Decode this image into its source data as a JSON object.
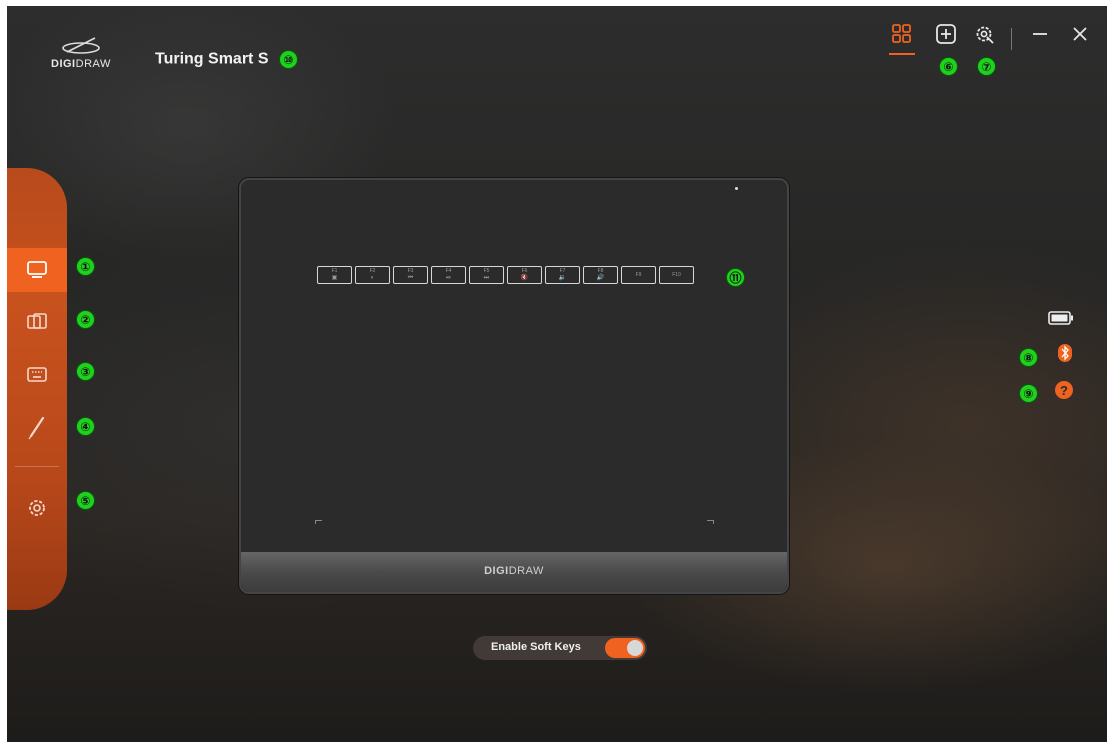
{
  "app": {
    "brand": "DIGIDRAW",
    "brand_bold": "DIGI",
    "brand_light": "DRAW",
    "device_name": "Turing Smart S",
    "accent": "#f0621f"
  },
  "topbar": {
    "buttons": [
      {
        "name": "device-overview",
        "icon": "grid-icon",
        "active": true
      },
      {
        "name": "add-device",
        "icon": "plus-square-icon"
      },
      {
        "name": "app-settings",
        "icon": "gear-badge-icon"
      },
      {
        "name": "minimize",
        "icon": "minimize-icon"
      },
      {
        "name": "close",
        "icon": "close-icon"
      }
    ]
  },
  "sidebar": {
    "items": [
      {
        "name": "display",
        "icon": "monitor-icon",
        "active": true
      },
      {
        "name": "multi-display",
        "icon": "screens-icon"
      },
      {
        "name": "keyboard",
        "icon": "keyboard-icon"
      },
      {
        "name": "pen",
        "icon": "pen-icon"
      },
      {
        "name": "settings",
        "icon": "gear-icon"
      }
    ]
  },
  "tablet": {
    "brand_bold": "DIGI",
    "brand_light": "DRAW",
    "hotkeys": [
      {
        "label": "F1",
        "glyph": "▣"
      },
      {
        "label": "F2",
        "glyph": "◐"
      },
      {
        "label": "F3",
        "glyph": "⏮"
      },
      {
        "label": "F4",
        "glyph": "⏯"
      },
      {
        "label": "F5",
        "glyph": "⏭"
      },
      {
        "label": "F6",
        "glyph": "🔇"
      },
      {
        "label": "F7",
        "glyph": "🔉"
      },
      {
        "label": "F8",
        "glyph": "🔊"
      },
      {
        "label": "F9",
        "glyph": ""
      },
      {
        "label": "F10",
        "glyph": ""
      }
    ]
  },
  "status": {
    "battery_icon": "battery-icon",
    "bluetooth_icon": "bluetooth-icon",
    "help_icon": "help-icon"
  },
  "soft_keys": {
    "label": "Enable Soft Keys",
    "enabled": true
  },
  "annotations": [
    "①",
    "②",
    "③",
    "④",
    "⑤",
    "⑥",
    "⑦",
    "⑧",
    "⑨",
    "⑩",
    "⑪"
  ]
}
